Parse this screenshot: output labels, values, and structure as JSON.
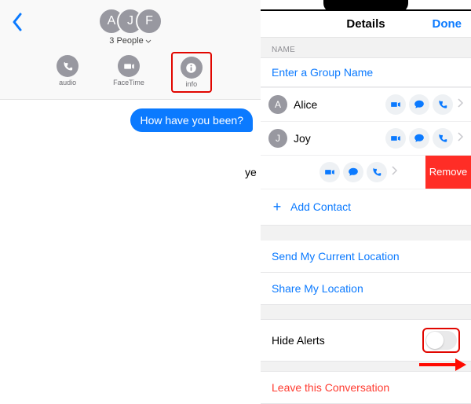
{
  "left": {
    "avatar_initials": [
      "A",
      "J",
      "F"
    ],
    "people_count_label": "3 People",
    "actions": {
      "audio_label": "audio",
      "facetime_label": "FaceTime",
      "info_label": "info"
    },
    "message_text": "How have you been?"
  },
  "right": {
    "header": {
      "title": "Details",
      "done_label": "Done"
    },
    "name_section_label": "NAME",
    "group_name_placeholder": "Enter a Group Name",
    "contacts": [
      {
        "initial": "A",
        "name": "Alice"
      },
      {
        "initial": "J",
        "name": "Joy"
      }
    ],
    "swiped_contact": {
      "name_fragment": "ye",
      "remove_label": "Remove"
    },
    "add_contact_label": "Add Contact",
    "send_location_label": "Send My Current Location",
    "share_location_label": "Share My Location",
    "hide_alerts_label": "Hide Alerts",
    "leave_label": "Leave this Conversation"
  }
}
